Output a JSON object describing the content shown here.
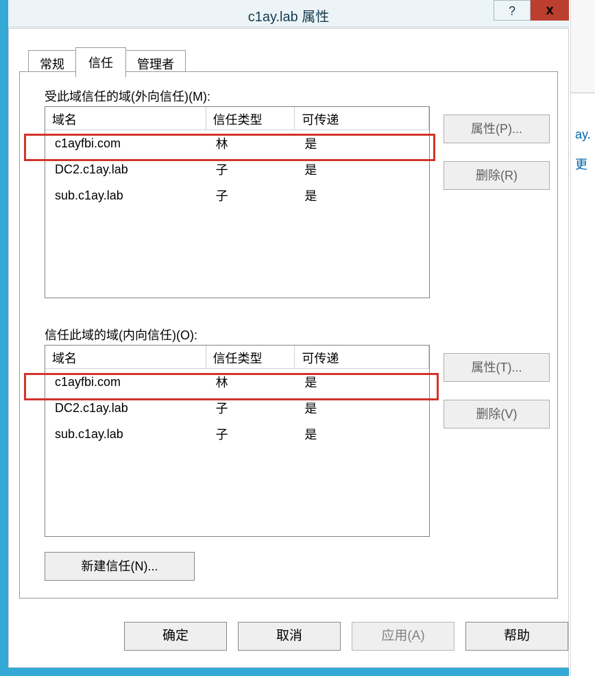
{
  "window": {
    "title": "c1ay.lab 属性",
    "help_glyph": "?",
    "close_glyph": "x"
  },
  "tabs": {
    "general": "常规",
    "trusts": "信任",
    "managed_by": "管理者"
  },
  "outgoing": {
    "label": "受此域信任的域(外向信任)(M):",
    "headers": {
      "name": "域名",
      "type": "信任类型",
      "trans": "可传递"
    },
    "rows": [
      {
        "name": "c1ayfbi.com",
        "type": "林",
        "trans": "是"
      },
      {
        "name": "DC2.c1ay.lab",
        "type": "子",
        "trans": "是"
      },
      {
        "name": "sub.c1ay.lab",
        "type": "子",
        "trans": "是"
      }
    ],
    "properties_btn": "属性(P)...",
    "remove_btn": "删除(R)"
  },
  "incoming": {
    "label": "信任此域的域(内向信任)(O):",
    "headers": {
      "name": "域名",
      "type": "信任类型",
      "trans": "可传递"
    },
    "rows": [
      {
        "name": "c1ayfbi.com",
        "type": "林",
        "trans": "是"
      },
      {
        "name": "DC2.c1ay.lab",
        "type": "子",
        "trans": "是"
      },
      {
        "name": "sub.c1ay.lab",
        "type": "子",
        "trans": "是"
      }
    ],
    "properties_btn": "属性(T)...",
    "remove_btn": "删除(V)"
  },
  "buttons": {
    "new_trust": "新建信任(N)...",
    "ok": "确定",
    "cancel": "取消",
    "apply": "应用(A)",
    "help": "帮助"
  },
  "right_fragments": {
    "frag1": "ay.",
    "frag2": "更"
  }
}
